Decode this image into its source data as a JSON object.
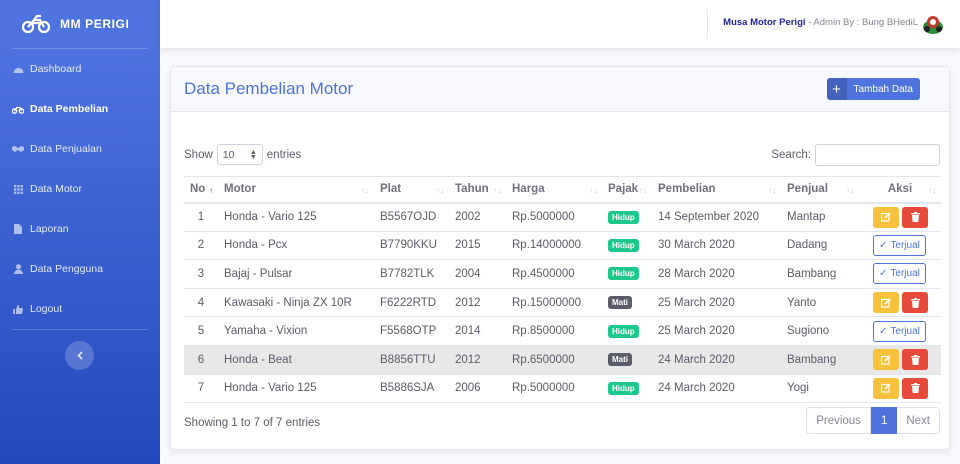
{
  "brand": {
    "name": "MM PERIGI",
    "icon": "motorcycle-icon"
  },
  "sidebar": {
    "items": [
      {
        "label": "Dashboard",
        "icon": "tachometer-icon",
        "active": false
      },
      {
        "label": "Data Pembelian",
        "icon": "motorcycle-icon",
        "active": true
      },
      {
        "label": "Data Penjualan",
        "icon": "handshake-icon",
        "active": false
      },
      {
        "label": "Data Motor",
        "icon": "grid-icon",
        "active": false
      },
      {
        "label": "Laporan",
        "icon": "file-icon",
        "active": false
      },
      {
        "label": "Data Pengguna",
        "icon": "user-icon",
        "active": false
      },
      {
        "label": "Logout",
        "icon": "thumbs-up-icon",
        "active": false
      }
    ],
    "toggle_icon": "chevron-left-icon"
  },
  "topbar": {
    "user_name": "Musa Motor Perigi",
    "user_role": " - Admin By : Bung BHediL"
  },
  "page": {
    "title": "Data Pembelian Motor",
    "add_button": "Tambah Data",
    "show_label": "Show",
    "entries_label": "entries",
    "length_value": "10",
    "search_label": "Search:",
    "search_value": "",
    "info": "Showing 1 to 7 of 7 entries",
    "pagination": {
      "previous": "Previous",
      "current": "1",
      "next": "Next"
    }
  },
  "table": {
    "columns": [
      "No",
      "Motor",
      "Plat",
      "Tahun",
      "Harga",
      "Pajak",
      "Pembelian",
      "Penjual",
      "Aksi"
    ],
    "rows": [
      {
        "no": "1",
        "motor": "Honda - Vario 125",
        "plat": "B5567OJD",
        "tahun": "2002",
        "harga": "Rp.5000000",
        "pajak": "Hidup",
        "pembelian": "14 September 2020",
        "penjual": "Mantap",
        "aksi": "edit-delete"
      },
      {
        "no": "2",
        "motor": "Honda - Pcx",
        "plat": "B7790KKU",
        "tahun": "2015",
        "harga": "Rp.14000000",
        "pajak": "Hidup",
        "pembelian": "30 March 2020",
        "penjual": "Dadang",
        "aksi": "terjual"
      },
      {
        "no": "3",
        "motor": "Bajaj - Pulsar",
        "plat": "B7782TLK",
        "tahun": "2004",
        "harga": "Rp.4500000",
        "pajak": "Hidup",
        "pembelian": "28 March 2020",
        "penjual": "Bambang",
        "aksi": "terjual"
      },
      {
        "no": "4",
        "motor": "Kawasaki - Ninja ZX 10R",
        "plat": "F6222RTD",
        "tahun": "2012",
        "harga": "Rp.15000000",
        "pajak": "Mati",
        "pembelian": "25 March 2020",
        "penjual": "Yanto",
        "aksi": "edit-delete"
      },
      {
        "no": "5",
        "motor": "Yamaha - Vixion",
        "plat": "F5568OTP",
        "tahun": "2014",
        "harga": "Rp.8500000",
        "pajak": "Hidup",
        "pembelian": "25 March 2020",
        "penjual": "Sugiono",
        "aksi": "terjual"
      },
      {
        "no": "6",
        "motor": "Honda - Beat",
        "plat": "B8856TTU",
        "tahun": "2012",
        "harga": "Rp.6500000",
        "pajak": "Mati",
        "pembelian": "24 March 2020",
        "penjual": "Bambang",
        "aksi": "edit-delete"
      },
      {
        "no": "7",
        "motor": "Honda - Vario 125",
        "plat": "B5886SJA",
        "tahun": "2006",
        "harga": "Rp.5000000",
        "pajak": "Hidup",
        "pembelian": "24 March 2020",
        "penjual": "Yogi",
        "aksi": "edit-delete"
      }
    ],
    "terjual_label": "Terjual",
    "highlighted_row": "6"
  },
  "colors": {
    "primary": "#4e73df",
    "success": "#1cc88a",
    "warning": "#f6c23e",
    "danger": "#e74a3b"
  }
}
